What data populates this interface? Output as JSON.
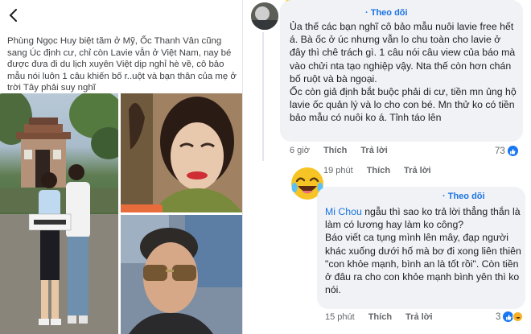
{
  "post": {
    "caption": "Phùng Ngọc Huy biệt tăm ở Mỹ, Ốc Thanh Vân cũng sang Úc định cư, chỉ còn Lavie vẫn ở Việt Nam, nay bé được đưa đi du lịch xuyên Việt dịp nghỉ hè về, cô bảo mẫu nói luôn 1 câu khiến bố r..uột và bạn thân của mẹ ở trời Tây phải suy nghĩ",
    "photo_sign_text": "⬛▬▬⬛"
  },
  "comments": [
    {
      "follow_label": "Theo dõi",
      "text": "Ủa thế các bạn nghĩ cô bảo mẫu nuôi lavie free hết á. Bà ốc ở úc nhưng vẫn lo chu toàn cho lavie ở đây thì chê trách gì. 1 câu nói câu view của báo mà vào chửi nta tạo nghiệp vậy. Nta thế còn hơn chán bố ruột và bà ngoại.\nỐc còn giả định bắt buộc phải di cư, tiền mn ủng hộ lavie ốc quản lý và lo cho con bé. Mn thử ko có tiền bảo mẫu có nuôi ko á. Tỉnh táo lên",
      "time": "6 giờ",
      "like_label": "Thích",
      "reply_label": "Trả lời",
      "reaction_count": "73"
    },
    {
      "follow_label": "Theo dõi",
      "text_prefix": "Mi Chou",
      "text": " ngẫu thì sao ko trả lời thẳng thắn là làm có lương hay làm ko công?\nBáo viết ca tụng mình lên mây, đạp người khác xuống dưới hố mà bơ đi xong liên thiên \"con khỏe mạnh, bình an là tốt rồi\". Còn tiền ở đâu ra cho con khỏe mạnh bình yên thì ko nói.",
      "time": "15 phút",
      "like_label": "Thích",
      "reply_label": "Trả lời",
      "reaction_count": "3"
    }
  ],
  "reply_row": {
    "time": "19 phút",
    "like_label": "Thích",
    "reply_label": "Trả lời"
  }
}
